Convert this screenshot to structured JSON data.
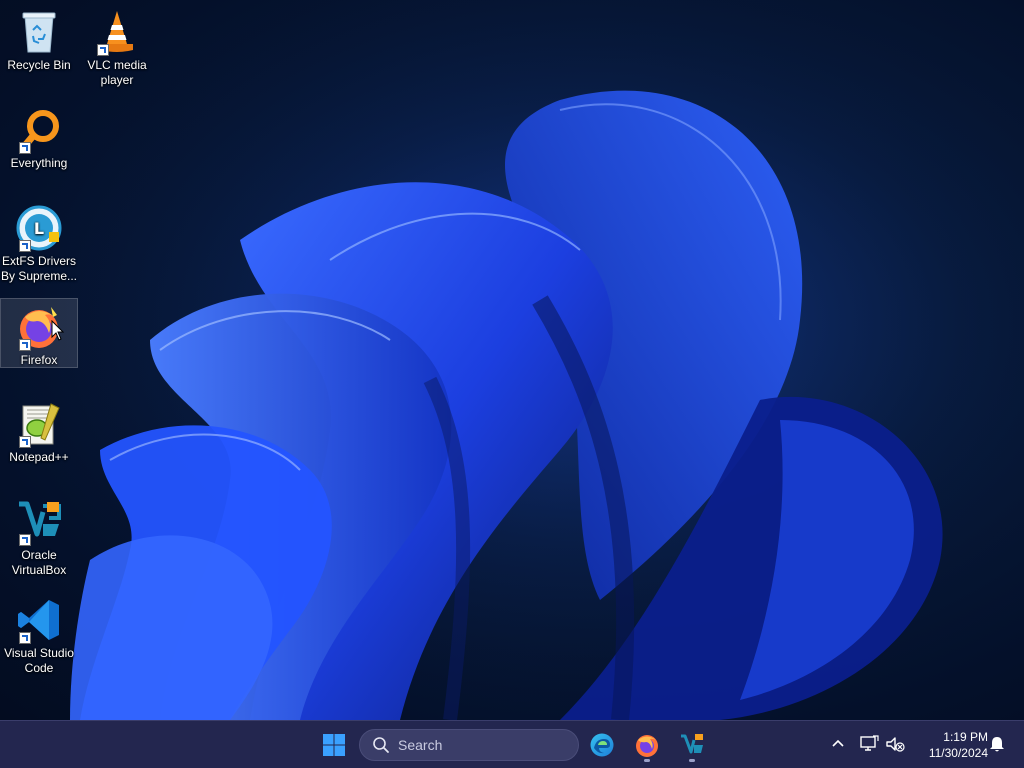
{
  "desktop": {
    "icons": [
      {
        "label": "Recycle Bin",
        "icon": "recycle-bin-icon"
      },
      {
        "label": "VLC media player",
        "icon": "vlc-cone-icon"
      },
      {
        "label": "Everything",
        "icon": "everything-search-icon"
      },
      {
        "label": "ExtFS Drivers By Supreme...",
        "icon": "extfs-drivers-icon"
      },
      {
        "label": "Firefox",
        "icon": "firefox-icon",
        "selected": true
      },
      {
        "label": "Notepad++",
        "icon": "notepadpp-icon"
      },
      {
        "label": "Oracle VirtualBox",
        "icon": "virtualbox-icon"
      },
      {
        "label": "Visual Studio Code",
        "icon": "vscode-icon"
      }
    ]
  },
  "taskbar": {
    "start_icon": "windows-start-icon",
    "search": {
      "placeholder": "Search"
    },
    "pinned": [
      {
        "name": "Microsoft Edge",
        "icon": "edge-icon"
      },
      {
        "name": "Firefox",
        "icon": "firefox-icon",
        "running": true
      },
      {
        "name": "Oracle VirtualBox",
        "icon": "virtualbox-icon",
        "running": true
      }
    ],
    "tray": {
      "overflow_icon": "chevron-up-icon",
      "network_icon": "network-icon",
      "volume_icon": "volume-muted-icon",
      "time": "1:19 PM",
      "date": "11/30/2024",
      "notification_icon": "bell-icon"
    }
  },
  "colors": {
    "taskbar_bg": "#23264f",
    "wallpaper_accent": "#1e4bff",
    "desktop_bg": "#061634"
  }
}
